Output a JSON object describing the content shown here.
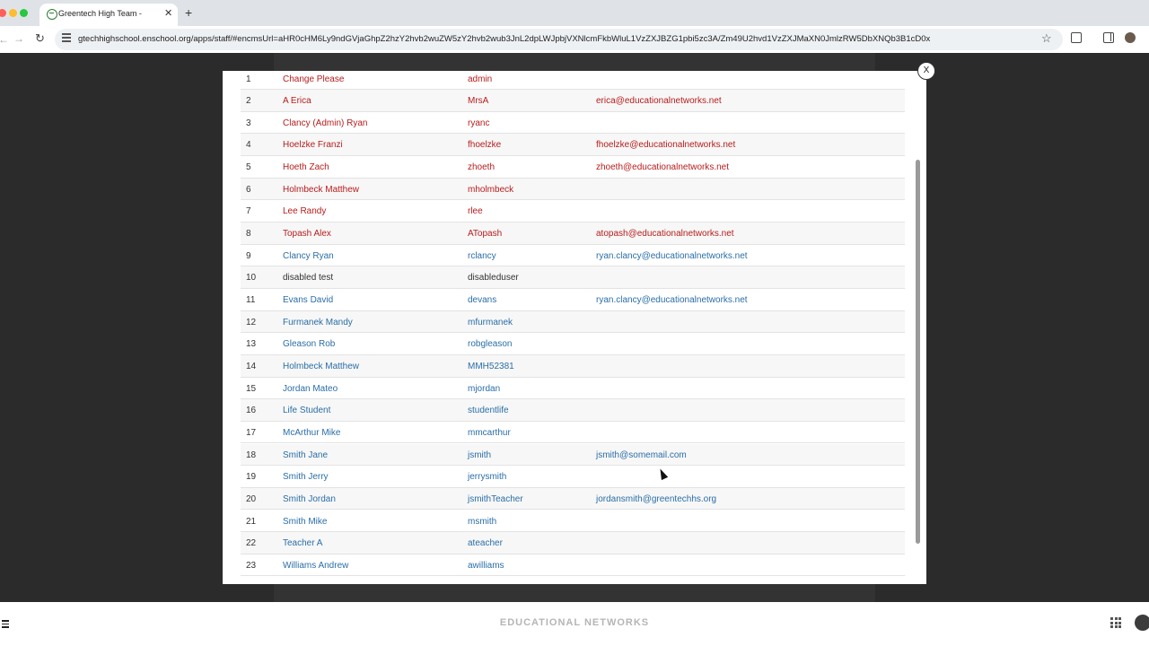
{
  "browser": {
    "tab_title": "Greentech High Team -",
    "tab_close": "✕",
    "new_tab": "+",
    "url": "gtechhighschool.enschool.org/apps/staff/#encmsUrl=aHR0cHM6Ly9ndGVjaGhpZ2hzY2hvb2wuZW5zY2hvb2wub3JnL2dpLWJpbjVXNlcmFkbWluL1VzZXJBZG1pbi5zc3A/Zm49U2hvd1VzZXJMaXN0JmlzRW5DbXNQb3B1cD0x"
  },
  "modal": {
    "close_label": "X",
    "rows": [
      {
        "num": "1",
        "name": "Change Please",
        "username": "admin",
        "email": "",
        "color": "red"
      },
      {
        "num": "2",
        "name": "A Erica",
        "username": "MrsA",
        "email": "erica@educationalnetworks.net",
        "color": "red"
      },
      {
        "num": "3",
        "name": "Clancy (Admin) Ryan",
        "username": "ryanc",
        "email": "",
        "color": "red"
      },
      {
        "num": "4",
        "name": "Hoelzke Franzi",
        "username": "fhoelzke",
        "email": "fhoelzke@educationalnetworks.net",
        "color": "red"
      },
      {
        "num": "5",
        "name": "Hoeth Zach",
        "username": "zhoeth",
        "email": "zhoeth@educationalnetworks.net",
        "color": "red"
      },
      {
        "num": "6",
        "name": "Holmbeck Matthew",
        "username": "mholmbeck",
        "email": "",
        "color": "red"
      },
      {
        "num": "7",
        "name": "Lee Randy",
        "username": "rlee",
        "email": "",
        "color": "red"
      },
      {
        "num": "8",
        "name": "Topash Alex",
        "username": "ATopash",
        "email": "atopash@educationalnetworks.net",
        "color": "red"
      },
      {
        "num": "9",
        "name": "Clancy Ryan",
        "username": "rclancy",
        "email": "ryan.clancy@educationalnetworks.net",
        "color": "blue"
      },
      {
        "num": "10",
        "name": "disabled test",
        "username": "disableduser",
        "email": "",
        "color": "gray"
      },
      {
        "num": "11",
        "name": "Evans David",
        "username": "devans",
        "email": "ryan.clancy@educationalnetworks.net",
        "color": "blue"
      },
      {
        "num": "12",
        "name": "Furmanek Mandy",
        "username": "mfurmanek",
        "email": "",
        "color": "blue"
      },
      {
        "num": "13",
        "name": "Gleason Rob",
        "username": "robgleason",
        "email": "",
        "color": "blue"
      },
      {
        "num": "14",
        "name": "Holmbeck Matthew",
        "username": "MMH52381",
        "email": "",
        "color": "blue"
      },
      {
        "num": "15",
        "name": "Jordan Mateo",
        "username": "mjordan",
        "email": "",
        "color": "blue"
      },
      {
        "num": "16",
        "name": "Life Student",
        "username": "studentlife",
        "email": "",
        "color": "blue"
      },
      {
        "num": "17",
        "name": "McArthur Mike",
        "username": "mmcarthur",
        "email": "",
        "color": "blue"
      },
      {
        "num": "18",
        "name": "Smith Jane",
        "username": "jsmith",
        "email": "jsmith@somemail.com",
        "color": "blue"
      },
      {
        "num": "19",
        "name": "Smith Jerry",
        "username": "jerrysmith",
        "email": "",
        "color": "blue"
      },
      {
        "num": "20",
        "name": "Smith Jordan",
        "username": "jsmithTeacher",
        "email": "jordansmith@greentechhs.org",
        "color": "blue"
      },
      {
        "num": "21",
        "name": "Smith Mike",
        "username": "msmith",
        "email": "",
        "color": "blue"
      },
      {
        "num": "22",
        "name": "Teacher A",
        "username": "ateacher",
        "email": "",
        "color": "blue"
      },
      {
        "num": "23",
        "name": "Williams Andrew",
        "username": "awilliams",
        "email": "",
        "color": "blue"
      }
    ]
  },
  "footer": {
    "brand": "EDUCATIONAL NETWORKS"
  },
  "icons": [
    "greentech-favicon",
    "back-arrow-icon",
    "forward-arrow-icon",
    "reload-icon",
    "site-info-icon",
    "star-icon",
    "extensions-icon",
    "side-panel-icon",
    "profile-icon",
    "close-icon",
    "hamburger-menu-icon",
    "apps-grid-icon"
  ]
}
